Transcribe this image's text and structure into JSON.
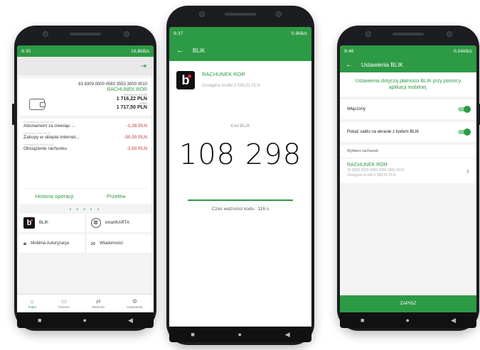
{
  "phone1": {
    "status_time": "9:35",
    "status_right": "16,8kB/s",
    "account_number": "83 8309 0000 0083 3553 3000 0010",
    "account_name": "RACHUNEK ROR",
    "available_label": "Dostępne środki",
    "available_value": "1 716,22 PLN",
    "balance_label": "Saldo",
    "balance_value": "1 717,50 PLN",
    "transactions": [
      {
        "date": "Powiadomia 2020-03-31",
        "title": "Abonament za miesiąc ...",
        "amount": "-1,28 PLN"
      },
      {
        "date": "Operacja 2020-03-31",
        "title": "Zakupy w sklepie internet...",
        "amount": "-50,00 PLN"
      },
      {
        "date": "Powiadomia 2020-03-31",
        "title": "Obciążenie rachunku",
        "amount": "-2,50 PLN"
      }
    ],
    "history_label": "Historia operacji",
    "transfer_label": "Przelew",
    "dots": "• • • • •",
    "tiles": [
      "BLIK",
      "smartKARTA",
      "Mobilna Autoryzacja",
      "Wiadomości"
    ],
    "tabs": [
      {
        "label": "Pulpit",
        "icon": "home-icon"
      },
      {
        "label": "Finanse",
        "icon": "wallet-icon"
      },
      {
        "label": "Płatności",
        "icon": "transfer-icon"
      },
      {
        "label": "Ustawienia",
        "icon": "gear-icon"
      }
    ]
  },
  "phone2": {
    "status_time": "9:37",
    "status_right": "0,9kB/s",
    "title": "BLIK",
    "account_name": "RACHUNEK ROR",
    "available": "Dostępne środki 3 588,51 PLN",
    "code_label": "Kod BLIK",
    "code": "108 298",
    "validity": "Czas ważności kodu : 116 s",
    "progress": 0.97
  },
  "phone3": {
    "status_time": "9:46",
    "status_right": "0,04kB/s",
    "title": "Ustawienia BLIK",
    "header_text": "Ustawienia dotyczą płatności BLIK przy pomocy aplikacji mobilnej.",
    "enabled_label": "Włączony",
    "show_balance_label": "Pokaż saldo na ekranie z kodem BLIK",
    "select_account_label": "Wybierz rachunek",
    "account_name": "RACHUNEK ROR",
    "account_number": "30 8309 0000 0083 2366 3000 0010",
    "account_available": "Dostępne środki 3 588,51 PLN",
    "save_label": "ZAPISZ"
  },
  "colors": {
    "accent": "#2d9a45",
    "negative": "#c7322f"
  }
}
